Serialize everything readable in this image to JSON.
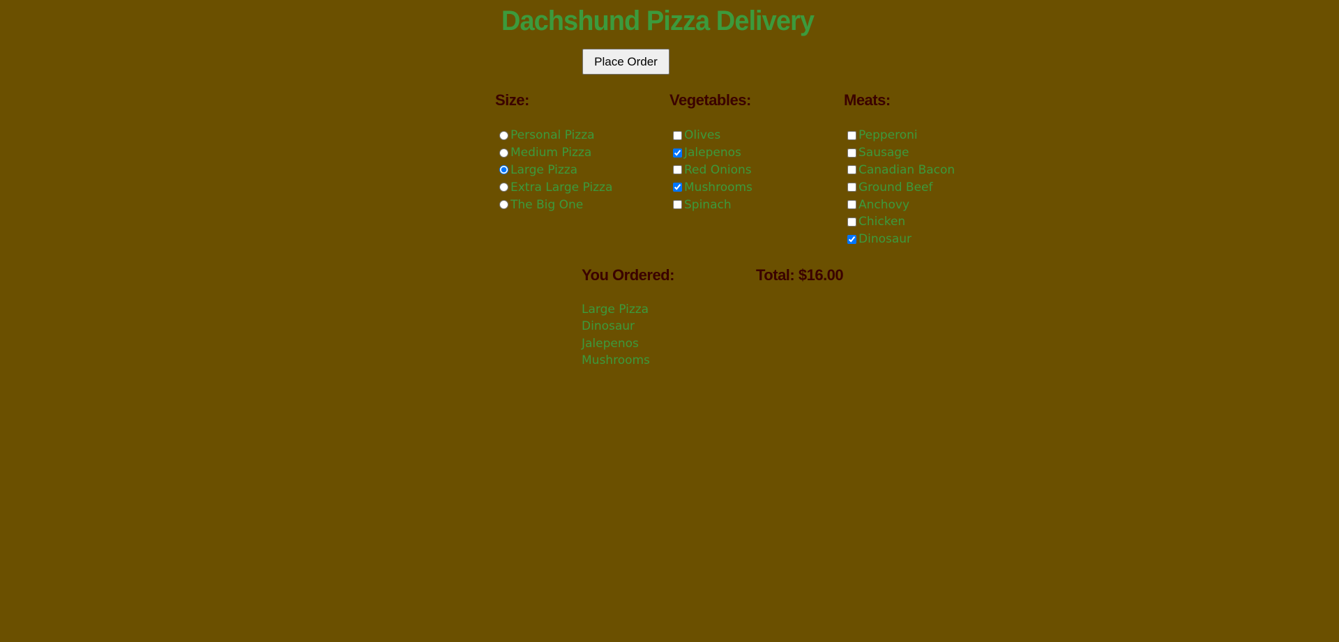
{
  "title": "Dachshund Pizza Delivery",
  "place_order_label": "Place Order",
  "size": {
    "heading": "Size:",
    "options": [
      {
        "label": "Personal Pizza",
        "checked": false
      },
      {
        "label": "Medium Pizza",
        "checked": false
      },
      {
        "label": "Large Pizza",
        "checked": true
      },
      {
        "label": "Extra Large Pizza",
        "checked": false
      },
      {
        "label": "The Big One",
        "checked": false
      }
    ]
  },
  "vegetables": {
    "heading": "Vegetables:",
    "options": [
      {
        "label": "Olives",
        "checked": false
      },
      {
        "label": "Jalepenos",
        "checked": true
      },
      {
        "label": "Red Onions",
        "checked": false
      },
      {
        "label": "Mushrooms",
        "checked": true
      },
      {
        "label": "Spinach",
        "checked": false
      }
    ]
  },
  "meats": {
    "heading": "Meats:",
    "options": [
      {
        "label": "Pepperoni",
        "checked": false
      },
      {
        "label": "Sausage",
        "checked": false
      },
      {
        "label": "Canadian Bacon",
        "checked": false
      },
      {
        "label": "Ground Beef",
        "checked": false
      },
      {
        "label": "Anchovy",
        "checked": false
      },
      {
        "label": "Chicken",
        "checked": false
      },
      {
        "label": "Dinosaur",
        "checked": true
      }
    ]
  },
  "summary": {
    "heading": "You Ordered:",
    "total": "Total: $16.00",
    "items": [
      "Large Pizza",
      "Dinosaur",
      "Jalepenos",
      "Mushrooms"
    ]
  },
  "colors": {
    "background": "#6b5000",
    "title": "#3c9a3c",
    "heading": "#3a0000",
    "option_text": "#3c9a3c"
  }
}
